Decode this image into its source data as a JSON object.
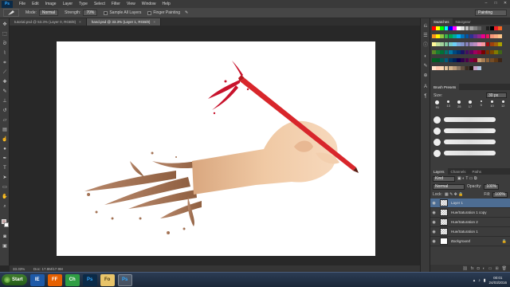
{
  "menubar": {
    "logo": "Ps",
    "items": [
      "File",
      "Edit",
      "Image",
      "Layer",
      "Type",
      "Select",
      "Filter",
      "View",
      "Window",
      "Help"
    ],
    "window_controls": [
      "–",
      "□",
      "✕"
    ]
  },
  "options": {
    "mode_label": "Mode:",
    "mode_value": "Normal",
    "strength_label": "Strength:",
    "strength_value": "70%",
    "sample_all_layers": "Sample All Layers",
    "finger_painting": "Finger Painting",
    "workspace": "Painting"
  },
  "doc_tabs": [
    {
      "title": "tutorial.psd @ 53.3% (Layer 0, RGB/8)",
      "close": "×"
    },
    {
      "title": "hand.psd @ 33.3% (Layer 1, RGB/8)",
      "close": "×",
      "active": true
    }
  ],
  "status": {
    "zoom": "33.33%",
    "doc": "Doc: 17.8M/17.9M"
  },
  "swatches_panel": {
    "tabs": [
      "Swatches",
      "Navigator"
    ],
    "colors": [
      "#ff0000",
      "#ffff00",
      "#00ff00",
      "#00ffff",
      "#0000ff",
      "#ff00ff",
      "#ffffff",
      "#e0e0e0",
      "#c0c0c0",
      "#a0a0a0",
      "#808080",
      "#606060",
      "#404040",
      "#202020",
      "#000000",
      "#ed1c24",
      "#f26522",
      "#f7941d",
      "#fff200",
      "#8dc63f",
      "#39b54a",
      "#00a651",
      "#00a99d",
      "#00aeef",
      "#0072bc",
      "#0054a6",
      "#2e3192",
      "#662d91",
      "#92278f",
      "#ec008c",
      "#ed145b",
      "#f69679",
      "#f9ad81",
      "#fdc68a",
      "#fff799",
      "#c4df9b",
      "#a3d39c",
      "#82ca9c",
      "#7accc8",
      "#6dcff6",
      "#7da7d9",
      "#8393ca",
      "#8781bd",
      "#a186be",
      "#bc8dbf",
      "#f49ac2",
      "#f6989d",
      "#9e0b0f",
      "#a0410d",
      "#a3620a",
      "#aba000",
      "#598527",
      "#197b30",
      "#007236",
      "#00746b",
      "#0076a3",
      "#004a80",
      "#003471",
      "#1b1464",
      "#440e62",
      "#630460",
      "#9e005d",
      "#9e0039",
      "#790000",
      "#7b2e00",
      "#7d4900",
      "#827b00",
      "#406618",
      "#005e20",
      "#005826",
      "#005952",
      "#005b7f",
      "#003663",
      "#002157",
      "#0d004c",
      "#32004b",
      "#4b0049",
      "#7b0046",
      "#7a0026",
      "#c69c6d",
      "#a67c52",
      "#8c6239",
      "#754c24",
      "#603913",
      "#3c2415",
      "#ffe6cc",
      "#ffccb3",
      "#ffd9b3",
      "#e6c8a0",
      "#d4b48c",
      "#b89878",
      "#8c7864",
      "#645040",
      "#3c2c20",
      "#1e140c",
      "#c8a2c8",
      "#b0c4de"
    ]
  },
  "brush_panel": {
    "tab": "Brush Presets",
    "size_label": "Size:",
    "size_value": "30 px",
    "tips": [
      "91",
      "13",
      "25",
      "17",
      "5",
      "10",
      "12"
    ]
  },
  "layers_panel": {
    "tabs": [
      "Layers",
      "Channels",
      "Paths"
    ],
    "kind": "Kind",
    "blend_mode": "Normal",
    "opacity_label": "Opacity:",
    "opacity_value": "100%",
    "lock_label": "Lock:",
    "fill_label": "Fill:",
    "fill_value": "100%",
    "layers": [
      "Layer 1",
      "Hue/Saturation 1 copy",
      "Hue/Saturation 2",
      "Hue/Saturation 1",
      "Background"
    ]
  },
  "taskbar": {
    "start": "Start",
    "time": "00:01",
    "date": "24/03/2016",
    "apps": [
      "IE",
      "FF",
      "Ch",
      "Ps",
      "Fo",
      "Ps"
    ]
  },
  "colors": {
    "pencil": "#d8262b",
    "splash": "#b17f5e",
    "skin": "#f0c9a4",
    "selected_layer": "#4d6d93"
  }
}
